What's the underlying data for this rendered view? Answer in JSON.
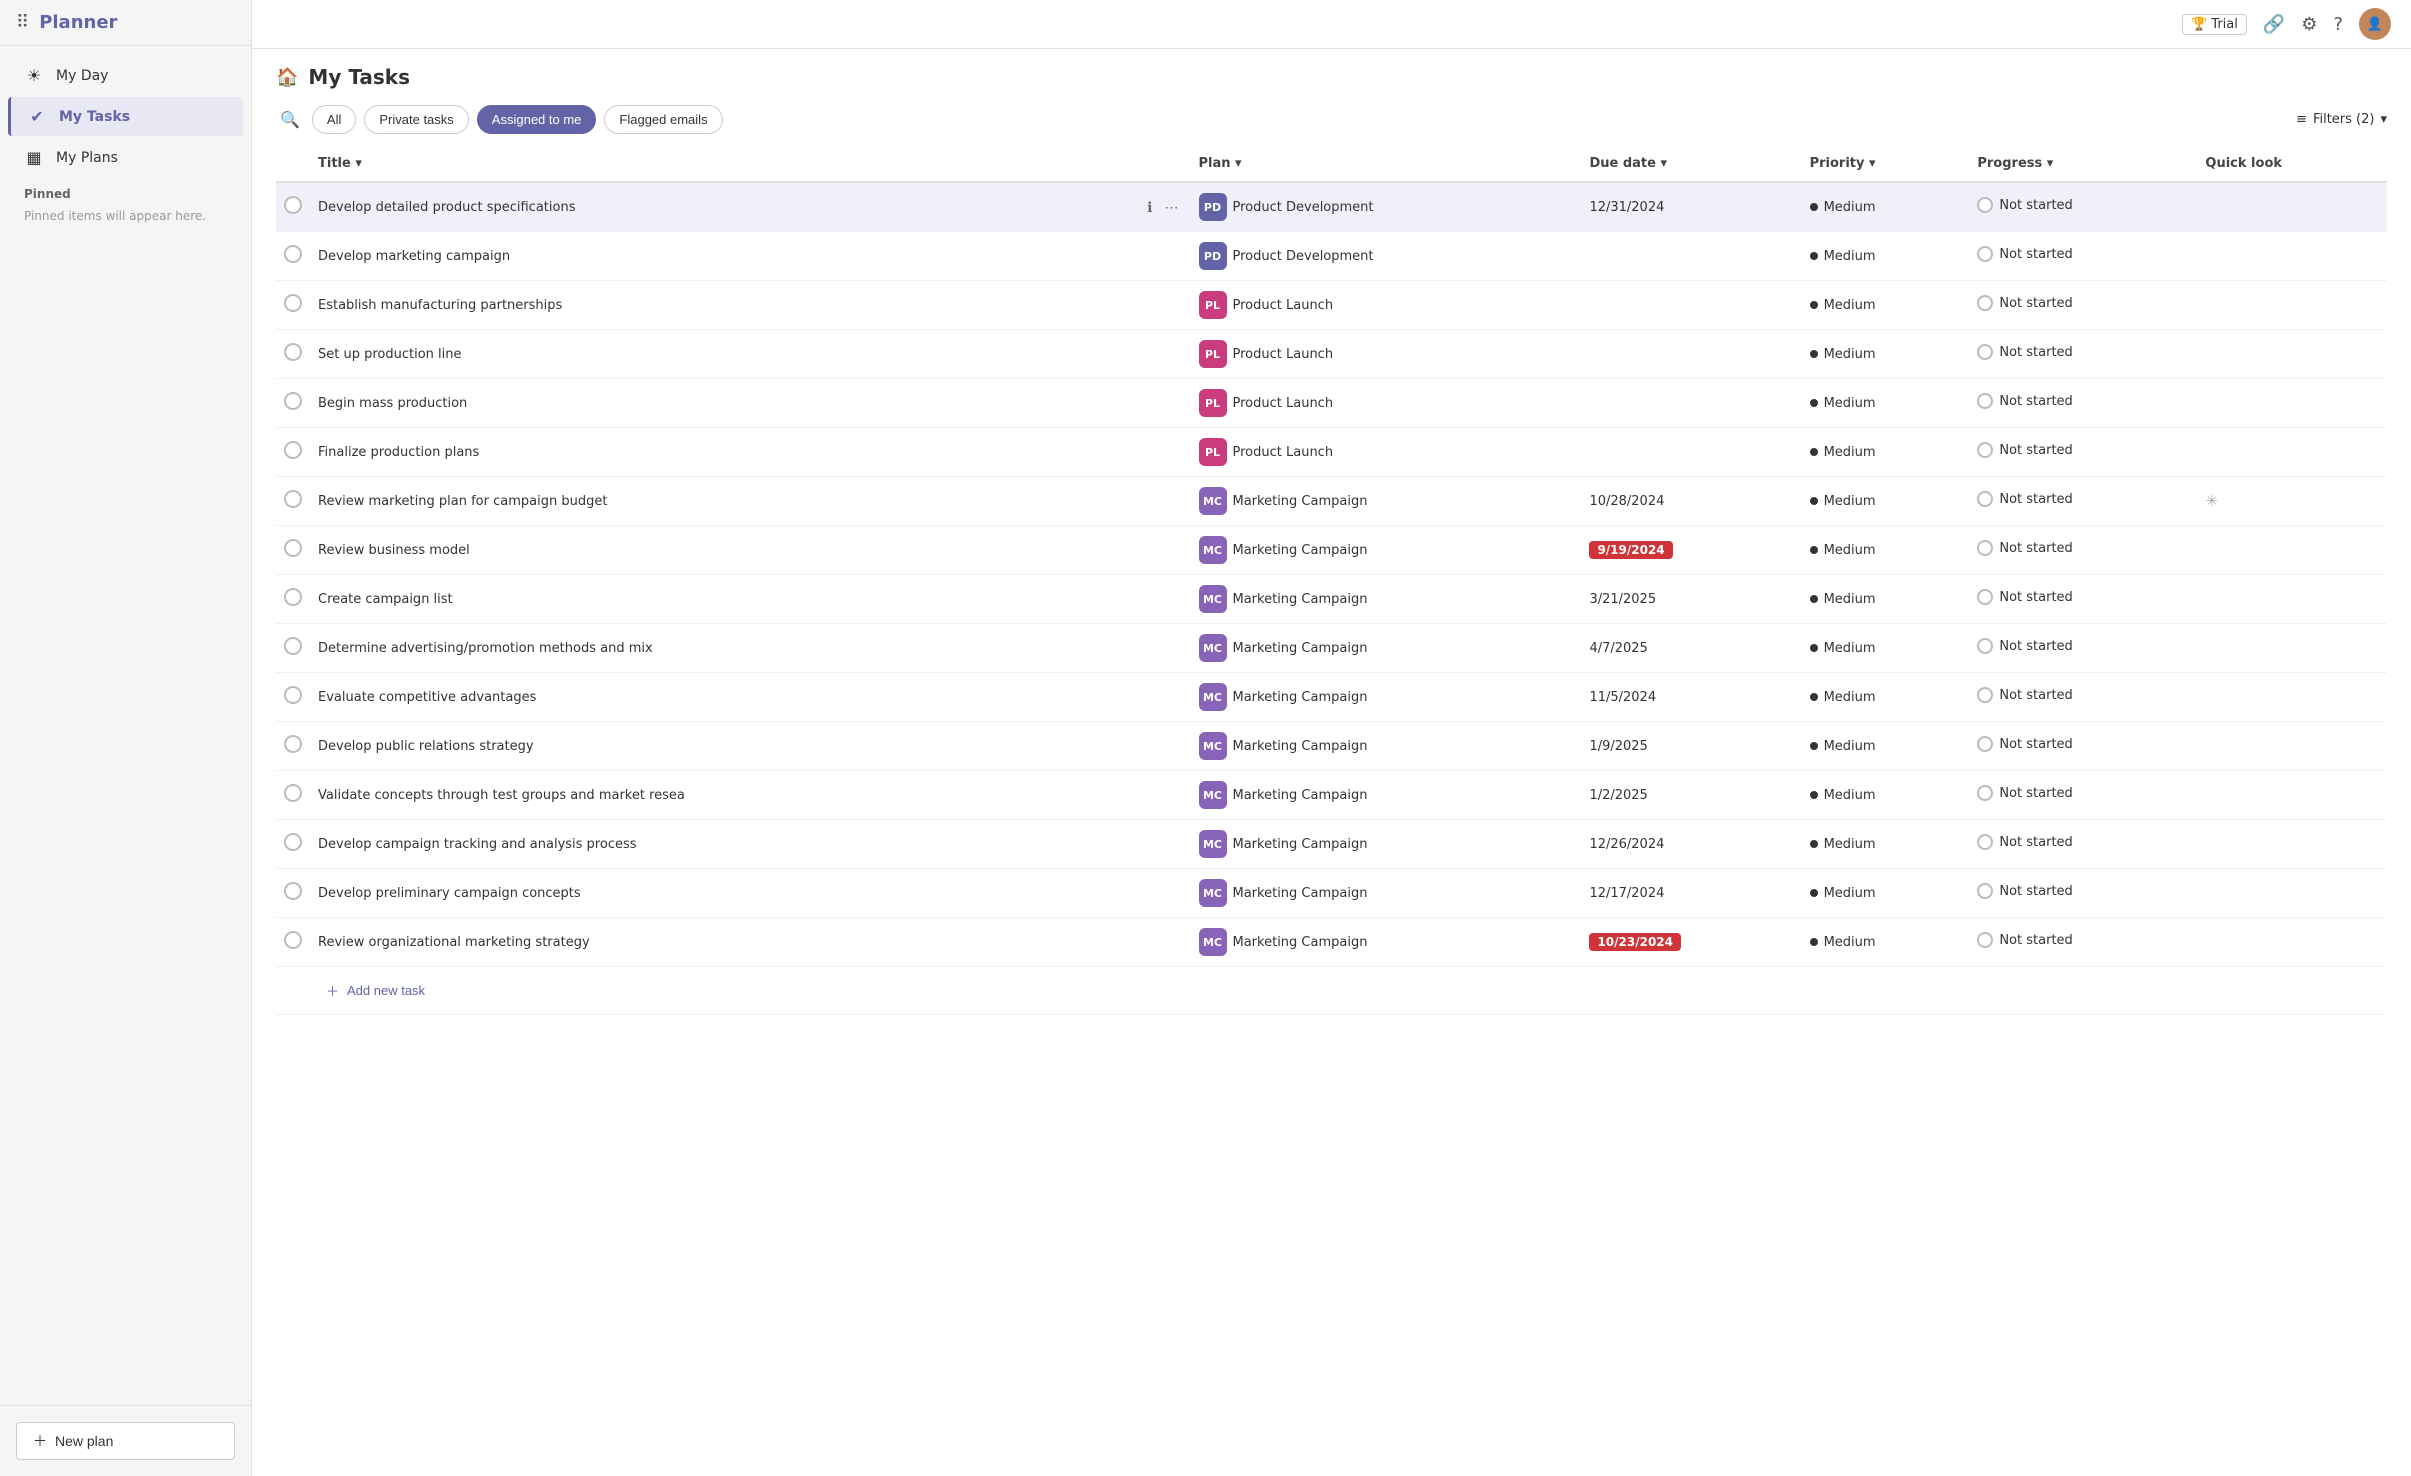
{
  "app": {
    "title": "Planner"
  },
  "topbar": {
    "trial_label": "Trial",
    "trial_icon": "🏆"
  },
  "sidebar": {
    "collapse_icon": "▪",
    "nav_items": [
      {
        "id": "my-day",
        "label": "My Day",
        "icon": "☀"
      },
      {
        "id": "my-tasks",
        "label": "My Tasks",
        "icon": "✔",
        "active": true
      },
      {
        "id": "my-plans",
        "label": "My Plans",
        "icon": "▦"
      }
    ],
    "pinned_label": "Pinned",
    "pinned_empty": "Pinned items will appear here.",
    "new_plan_label": "New plan"
  },
  "page": {
    "title": "My Tasks",
    "icon": "🏠"
  },
  "filters": {
    "search_placeholder": "Search",
    "buttons": [
      {
        "id": "all",
        "label": "All",
        "active": false
      },
      {
        "id": "private-tasks",
        "label": "Private tasks",
        "active": false
      },
      {
        "id": "assigned-to-me",
        "label": "Assigned to me",
        "active": true
      },
      {
        "id": "flagged-emails",
        "label": "Flagged emails",
        "active": false
      }
    ],
    "filter_label": "Filters (2)",
    "filter_icon": "≡"
  },
  "table": {
    "columns": [
      {
        "id": "title",
        "label": "Title"
      },
      {
        "id": "plan",
        "label": "Plan"
      },
      {
        "id": "due-date",
        "label": "Due date"
      },
      {
        "id": "priority",
        "label": "Priority"
      },
      {
        "id": "progress",
        "label": "Progress"
      },
      {
        "id": "quick-look",
        "label": "Quick look"
      }
    ],
    "rows": [
      {
        "id": 1,
        "title": "Develop detailed product specifications",
        "plan_badge": "PD",
        "plan_color": "#6264a7",
        "plan_label": "Product Development",
        "due_date": "12/31/2024",
        "due_overdue": false,
        "priority": "Medium",
        "progress": "Not started",
        "selected": true,
        "quick_look": false
      },
      {
        "id": 2,
        "title": "Develop marketing campaign",
        "plan_badge": "PD",
        "plan_color": "#6264a7",
        "plan_label": "Product Development",
        "due_date": "",
        "due_overdue": false,
        "priority": "Medium",
        "progress": "Not started",
        "selected": false,
        "quick_look": false
      },
      {
        "id": 3,
        "title": "Establish manufacturing partnerships",
        "plan_badge": "PL",
        "plan_color": "#ca3c7d",
        "plan_label": "Product Launch",
        "due_date": "",
        "due_overdue": false,
        "priority": "Medium",
        "progress": "Not started",
        "selected": false,
        "quick_look": false
      },
      {
        "id": 4,
        "title": "Set up production line",
        "plan_badge": "PL",
        "plan_color": "#ca3c7d",
        "plan_label": "Product Launch",
        "due_date": "",
        "due_overdue": false,
        "priority": "Medium",
        "progress": "Not started",
        "selected": false,
        "quick_look": false
      },
      {
        "id": 5,
        "title": "Begin mass production",
        "plan_badge": "PL",
        "plan_color": "#ca3c7d",
        "plan_label": "Product Launch",
        "due_date": "",
        "due_overdue": false,
        "priority": "Medium",
        "progress": "Not started",
        "selected": false,
        "quick_look": false
      },
      {
        "id": 6,
        "title": "Finalize production plans",
        "plan_badge": "PL",
        "plan_color": "#ca3c7d",
        "plan_label": "Product Launch",
        "due_date": "",
        "due_overdue": false,
        "priority": "Medium",
        "progress": "Not started",
        "selected": false,
        "quick_look": false
      },
      {
        "id": 7,
        "title": "Review marketing plan for campaign budget",
        "plan_badge": "MC",
        "plan_color": "#8764b8",
        "plan_label": "Marketing Campaign",
        "due_date": "10/28/2024",
        "due_overdue": false,
        "priority": "Medium",
        "progress": "Not started",
        "selected": false,
        "quick_look": true
      },
      {
        "id": 8,
        "title": "Review business model",
        "plan_badge": "MC",
        "plan_color": "#8764b8",
        "plan_label": "Marketing Campaign",
        "due_date": "9/19/2024",
        "due_overdue": true,
        "priority": "Medium",
        "progress": "Not started",
        "selected": false,
        "quick_look": false
      },
      {
        "id": 9,
        "title": "Create campaign list",
        "plan_badge": "MC",
        "plan_color": "#8764b8",
        "plan_label": "Marketing Campaign",
        "due_date": "3/21/2025",
        "due_overdue": false,
        "priority": "Medium",
        "progress": "Not started",
        "selected": false,
        "quick_look": false
      },
      {
        "id": 10,
        "title": "Determine advertising/promotion methods and mix",
        "plan_badge": "MC",
        "plan_color": "#8764b8",
        "plan_label": "Marketing Campaign",
        "due_date": "4/7/2025",
        "due_overdue": false,
        "priority": "Medium",
        "progress": "Not started",
        "selected": false,
        "quick_look": false
      },
      {
        "id": 11,
        "title": "Evaluate competitive advantages",
        "plan_badge": "MC",
        "plan_color": "#8764b8",
        "plan_label": "Marketing Campaign",
        "due_date": "11/5/2024",
        "due_overdue": false,
        "priority": "Medium",
        "progress": "Not started",
        "selected": false,
        "quick_look": false
      },
      {
        "id": 12,
        "title": "Develop public relations strategy",
        "plan_badge": "MC",
        "plan_color": "#8764b8",
        "plan_label": "Marketing Campaign",
        "due_date": "1/9/2025",
        "due_overdue": false,
        "priority": "Medium",
        "progress": "Not started",
        "selected": false,
        "quick_look": false
      },
      {
        "id": 13,
        "title": "Validate concepts through test groups and market resea",
        "plan_badge": "MC",
        "plan_color": "#8764b8",
        "plan_label": "Marketing Campaign",
        "due_date": "1/2/2025",
        "due_overdue": false,
        "priority": "Medium",
        "progress": "Not started",
        "selected": false,
        "quick_look": false
      },
      {
        "id": 14,
        "title": "Develop campaign tracking and analysis process",
        "plan_badge": "MC",
        "plan_color": "#8764b8",
        "plan_label": "Marketing Campaign",
        "due_date": "12/26/2024",
        "due_overdue": false,
        "priority": "Medium",
        "progress": "Not started",
        "selected": false,
        "quick_look": false
      },
      {
        "id": 15,
        "title": "Develop preliminary campaign concepts",
        "plan_badge": "MC",
        "plan_color": "#8764b8",
        "plan_label": "Marketing Campaign",
        "due_date": "12/17/2024",
        "due_overdue": false,
        "priority": "Medium",
        "progress": "Not started",
        "selected": false,
        "quick_look": false
      },
      {
        "id": 16,
        "title": "Review organizational marketing strategy",
        "plan_badge": "MC",
        "plan_color": "#8764b8",
        "plan_label": "Marketing Campaign",
        "due_date": "10/23/2024",
        "due_overdue": true,
        "priority": "Medium",
        "progress": "Not started",
        "selected": false,
        "quick_look": false
      }
    ],
    "add_task_label": "Add new task"
  }
}
